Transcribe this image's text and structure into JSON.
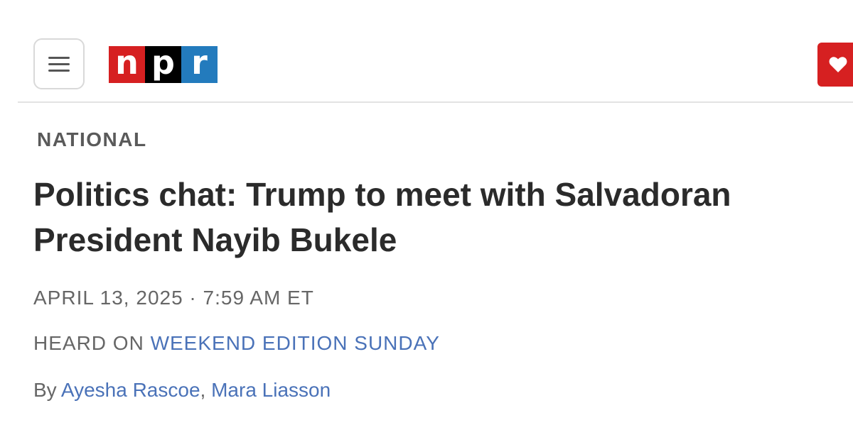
{
  "header": {
    "menu_icon": "hamburger-menu-icon",
    "logo": {
      "letters": [
        "n",
        "p",
        "r"
      ],
      "colors": [
        "#d62021",
        "#000000",
        "#237bbd"
      ]
    },
    "donate_icon": "heart-icon",
    "donate_color": "#d62021"
  },
  "article": {
    "section": "NATIONAL",
    "headline": "Politics chat: Trump to meet with Salvadoran President Nayib Bukele",
    "dateline": "APRIL 13, 2025 · 7:59 AM ET",
    "heard_on_prefix": "HEARD ON",
    "heard_on_program": "WEEKEND EDITION SUNDAY",
    "byline_prefix": "By",
    "authors": [
      "Ayesha Rascoe",
      "Mara Liasson"
    ],
    "author_separator": ", "
  },
  "colors": {
    "link": "#4a72b8",
    "headline": "#2b2b2b",
    "meta": "#666666"
  }
}
